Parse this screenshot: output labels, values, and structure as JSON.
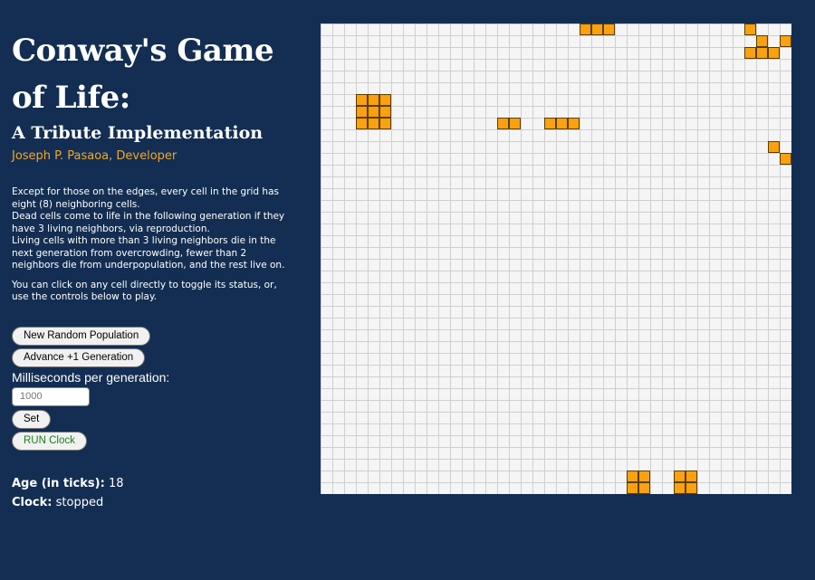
{
  "title": "Conway's Game of Life:",
  "subtitle": "A Tribute Implementation",
  "developer": "Joseph P. Pasaoa, Developer",
  "description": {
    "p1_lines": [
      "Except for those on the edges, every cell in the grid has eight (8) neighboring cells.",
      "Dead cells come to life in the following generation if they have 3 living neighbors, via reproduction.",
      "Living cells with more than 3 living neighbors die in the next generation from overcrowding, fewer than 2 neighbors die from underpopulation, and the rest live on."
    ],
    "p2": "You can click on any cell directly to toggle its status, or, use the controls below to play."
  },
  "controls": {
    "new_random_label": "New Random Population",
    "advance_label": "Advance +1 Generation",
    "ms_label": "Milliseconds per generation:",
    "ms_placeholder": "1000",
    "set_label": "Set",
    "run_label": "RUN Clock"
  },
  "stats": {
    "age_label": "Age (in ticks):",
    "age_value": "18",
    "clock_label": "Clock:",
    "clock_value": "stopped"
  },
  "colors": {
    "background": "#132e52",
    "live_cell": "#f9a10f",
    "accent": "#f5a623"
  },
  "grid": {
    "rows": 40,
    "cols": 40,
    "live_rows": [
      "......................ooo...........o...",
      ".....................................o.o",
      "....................................ooo.",
      "........................................",
      "........................................",
      "........................................",
      "...ooo..................................",
      "...ooo..................................",
      "...ooo.........oo..ooo..................",
      "........................................",
      "......................................o.",
      ".......................................o",
      "........................................",
      ".........................................",
      ".........................................",
      ".........................................",
      "........................................",
      "........................................",
      "........................................",
      "........................................",
      "........................................",
      "........................................",
      "........................................",
      "........................................",
      "........................................",
      "........................................",
      "........................................",
      "........................................",
      "........................................",
      "........................................",
      "........................................",
      "........................................",
      "........................................",
      "........................................",
      "........................................",
      "........................................",
      "........................................",
      "........................................",
      "..........................oo..oo........",
      "..........................oo..oo........"
    ]
  }
}
